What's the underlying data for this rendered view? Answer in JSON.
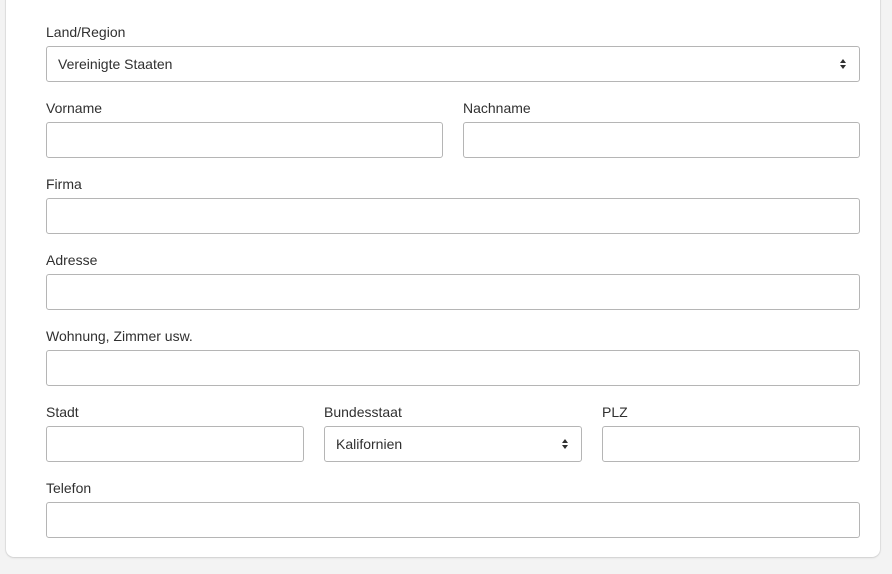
{
  "form": {
    "country": {
      "label": "Land/Region",
      "value": "Vereinigte Staaten"
    },
    "first_name": {
      "label": "Vorname",
      "value": ""
    },
    "last_name": {
      "label": "Nachname",
      "value": ""
    },
    "company": {
      "label": "Firma",
      "value": ""
    },
    "address": {
      "label": "Adresse",
      "value": ""
    },
    "apartment": {
      "label": "Wohnung, Zimmer usw.",
      "value": ""
    },
    "city": {
      "label": "Stadt",
      "value": ""
    },
    "state": {
      "label": "Bundesstaat",
      "value": "Kalifornien"
    },
    "zip": {
      "label": "PLZ",
      "value": ""
    },
    "phone": {
      "label": "Telefon",
      "value": ""
    }
  },
  "icons": {
    "select_arrows": "updown-chevron-icon"
  },
  "colors": {
    "page_background": "#f3f3f3",
    "card_background": "#ffffff",
    "input_border": "#b5b5b5",
    "text": "#303030"
  }
}
